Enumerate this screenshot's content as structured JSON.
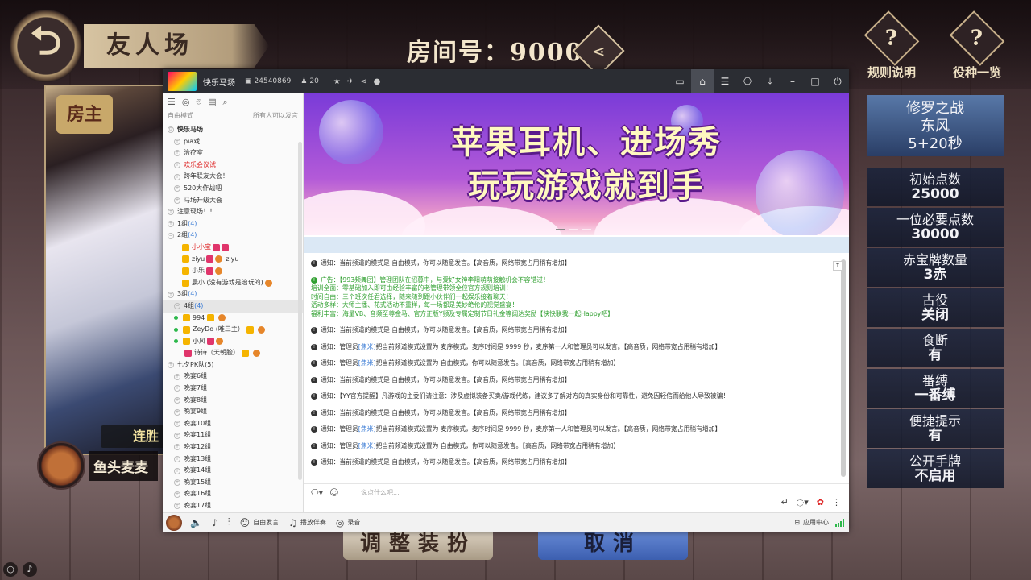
{
  "game": {
    "title": "友人场",
    "room_label": "房间号：90001",
    "back_icon": "back-arrow-icon",
    "share_icon": "share-icon",
    "rules_btn": "规则说明",
    "yaku_btn": "役种一览",
    "host_badge": "房主",
    "win_badge": "连胜",
    "player_name": "鱼头麦麦",
    "rules": [
      {
        "label": "修罗之战",
        "value": "东风",
        "extra": "5+20秒"
      },
      {
        "label": "初始点数",
        "value": "25000"
      },
      {
        "label": "一位必要点数",
        "value": "30000"
      },
      {
        "label": "赤宝牌数量",
        "value": "3赤"
      },
      {
        "label": "古役",
        "value": "关闭"
      },
      {
        "label": "食断",
        "value": "有"
      },
      {
        "label": "番缚",
        "value": "一番缚"
      },
      {
        "label": "便捷提示",
        "value": "有"
      },
      {
        "label": "公开手牌",
        "value": "不启用"
      }
    ],
    "adjust_btn": "调整装扮",
    "cancel_btn": "取消"
  },
  "yy": {
    "channel_name": "快乐马场",
    "channel_id": "24540869",
    "user_count": "20",
    "sidebar": {
      "mode": "自由模式",
      "mode_right": "所有人可以发言",
      "root": "快乐马场",
      "channels": [
        "pia戏",
        "治疗室",
        "欢乐会议试",
        "跨年联友大会！",
        "520大作战吧",
        "马场升级大会",
        "注意现场！！"
      ],
      "group1": {
        "name": "1组",
        "count": "(4)"
      },
      "group2": {
        "name": "2组",
        "count": "(4)"
      },
      "group2_members": [
        "小小宝",
        "ziyu",
        "小乐",
        "晨小 (没有游戏是治玩的)"
      ],
      "group2_member_tail": "ziyu",
      "group3": {
        "name": "3组",
        "count": "(4)"
      },
      "group4": {
        "name": "4组",
        "count": "(4)"
      },
      "group4_members": [
        "994",
        "ZeyDo (唯三主）",
        "小风",
        "诗诗（天朝脸）"
      ],
      "group_last": "七夕PK队(5)",
      "rest": [
        "晚宴6组",
        "晚宴7组",
        "晚宴8组",
        "晚宴9组",
        "晚宴10组",
        "晚宴11组",
        "晚宴12组",
        "晚宴13组",
        "晚宴14组",
        "晚宴15组",
        "晚宴16组",
        "晚宴17组"
      ]
    },
    "banner": {
      "line1": "苹果耳机、进场秀",
      "line2": "玩玩游戏就到手"
    },
    "messages": [
      {
        "type": "notice",
        "text": "通知：当前频道的模式是 自由模式，你可以随意发言。【高音质，网络带宽占用稍有增加】"
      },
      {
        "type": "ad",
        "lines": [
          "广告：【993频舞团】管理团队在招募中，与爱好女神李阳萌萌接触机会不容错过！",
          "培训全面：零基础加入即可由经验丰富的老管理带领全位官方规则培训！",
          "时间自由：三个班次任君选择，随来随到跟小伙伴们一起娱乐接着聊天！",
          "活动多样：大师主播、花式活动不重样，每一场都是美妙绝伦的视觉盛宴！",
          "福利丰富：海量VB、音频至尊金马、官方正版Y频及专属定制节日礼金等阔达奖励【快快联我一起Happy吧】"
        ]
      },
      {
        "type": "notice",
        "text": "通知：当前频道的模式是 自由模式，你可以随意发言。【高音质，网络带宽占用稍有增加】"
      },
      {
        "type": "notice",
        "prefix": "通知：管理员 ",
        "link": "[焦米]",
        "text": " 把当前频道模式设置为 麦序模式，麦序时间是 9999 秒，麦序第一人和管理员可以发言。【高音质，网络带宽占用稍有增加】"
      },
      {
        "type": "notice",
        "prefix": "通知：管理员 ",
        "link": "[焦米]",
        "text": " 把当前频道模式设置为 自由模式，你可以随意发言。【高音质，网络带宽占用稍有增加】"
      },
      {
        "type": "notice",
        "text": "通知：当前频道的模式是 自由模式，你可以随意发言。【高音质，网络带宽占用稍有增加】"
      },
      {
        "type": "notice",
        "text": "通知：【YY官方提醒】凡游戏的主委们请注意：涉及虚拟装备买卖/游戏代练，建议多了解对方的真实身份和可靠性，避免因轻信而给他人导致被骗！"
      },
      {
        "type": "notice",
        "text": "通知：当前频道的模式是 自由模式，你可以随意发言。【高音质，网络带宽占用稍有增加】"
      },
      {
        "type": "notice",
        "prefix": "通知：管理员 ",
        "link": "[焦米]",
        "text": " 把当前频道模式设置为 麦序模式，麦序时间是 9999 秒，麦序第一人和管理员可以发言。【高音质，网络带宽占用稍有增加】"
      },
      {
        "type": "notice",
        "prefix": "通知：管理员 ",
        "link": "[焦米]",
        "text": " 把当前频道模式设置为 自由模式，你可以随意发言。【高音质，网络带宽占用稍有增加】"
      },
      {
        "type": "notice",
        "text": "通知：当前频道的模式是 自由模式，你可以随意发言。【高音质，网络带宽占用稍有增加】"
      }
    ],
    "input_placeholder": "说点什么吧...",
    "bottom": {
      "free_speak": "自由发言",
      "play_accompany": "播放伴奏",
      "record": "录音",
      "app_center": "应用中心"
    }
  }
}
